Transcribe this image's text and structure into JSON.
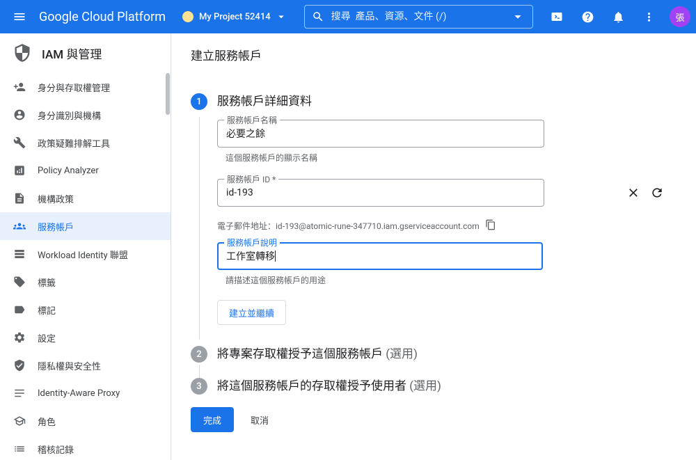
{
  "header": {
    "logo": "Google Cloud Platform",
    "project_name": "My Project 52414",
    "search_placeholder": "搜尋  產品、資源、文件 (/)",
    "avatar_initial": "張"
  },
  "sidebar": {
    "title": "IAM 與管理",
    "items": [
      {
        "icon": "people-add",
        "label": "身分與存取權管理"
      },
      {
        "icon": "person-circle",
        "label": "身分識別與機構"
      },
      {
        "icon": "wrench",
        "label": "政策疑難排解工具"
      },
      {
        "icon": "analyzer",
        "label": "Policy Analyzer"
      },
      {
        "icon": "doc",
        "label": "機構政策"
      },
      {
        "icon": "service-account",
        "label": "服務帳戶",
        "active": true
      },
      {
        "icon": "workload",
        "label": "Workload Identity 聯盟"
      },
      {
        "icon": "tag",
        "label": "標籤"
      },
      {
        "icon": "label",
        "label": "標記"
      },
      {
        "icon": "gear",
        "label": "設定"
      },
      {
        "icon": "shield-check",
        "label": "隱私權與安全性"
      },
      {
        "icon": "iap",
        "label": "Identity-Aware Proxy"
      },
      {
        "icon": "hat",
        "label": "角色"
      },
      {
        "icon": "list",
        "label": "稽核記錄"
      }
    ]
  },
  "main": {
    "page_title": "建立服務帳戶",
    "step1": {
      "num": "1",
      "title": "服務帳戶詳細資料",
      "name_label": "服務帳戶名稱",
      "name_value": "必要之餘",
      "name_helper": "這個服務帳戶的顯示名稱",
      "id_label": "服務帳戶 ID *",
      "id_value": "id-193",
      "email_prefix": "電子郵件地址：",
      "email_value": "id-193@atomic-rune-347710.iam.gserviceaccount.com",
      "desc_label": "服務帳戶說明",
      "desc_value": "工作室轉移",
      "desc_helper": "請描述這個服務帳戶的用途",
      "continue_btn": "建立並繼續"
    },
    "step2": {
      "num": "2",
      "title": "將專案存取權授予這個服務帳戶 ",
      "optional": "(選用)"
    },
    "step3": {
      "num": "3",
      "title": "將這個服務帳戶的存取權授予使用者 ",
      "optional": "(選用)"
    },
    "done_btn": "完成",
    "cancel_btn": "取消"
  }
}
